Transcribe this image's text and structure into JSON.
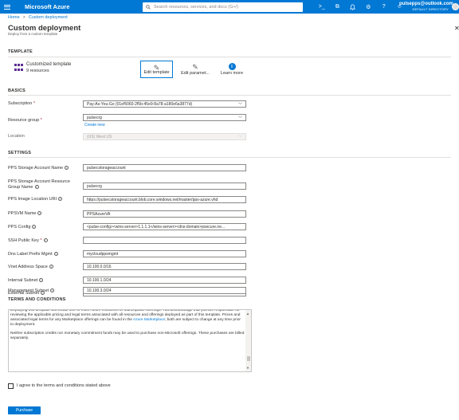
{
  "topbar": {
    "brand": "Microsoft Azure",
    "search_placeholder": "Search resources, services, and docs (G+/)",
    "icons": [
      "terminal-icon",
      "directory-filter-icon",
      "bell-icon",
      "gear-icon",
      "help-icon",
      "feedback-icon"
    ],
    "icon_glyphs": [
      ">_",
      "⧉",
      "🔔",
      "⚙",
      "?",
      "☺"
    ],
    "user_email": "pulsepps@outlook.com",
    "user_dir": "DEFAULT DIRECTORY"
  },
  "breadcrumb": {
    "home": "Home",
    "sep": ">",
    "current": "Custom deployment"
  },
  "page": {
    "title": "Custom deployment",
    "subtitle": "Deploy from a custom template"
  },
  "template": {
    "heading": "TEMPLATE",
    "name": "Customized template",
    "resources": "9 resources",
    "edit_template": "Edit template",
    "edit_params": "Edit paramet...",
    "learn_more": "Learn more"
  },
  "basics": {
    "heading": "BASICS",
    "subscription_label": "Subscription",
    "subscription_value": "Pay-As-You-Go (01ef5060-2f5b-45e9-8a78-a180e6a3877d)",
    "rg_label": "Resource group",
    "rg_value": "pulsecrg",
    "create_new": "Create new",
    "location_label": "Location",
    "location_value": "(US) West US"
  },
  "settings": {
    "heading": "SETTINGS",
    "fields": [
      {
        "label": "PPS Storage Account Name",
        "value": "pulsecstorageaccount"
      },
      {
        "label": "PPS Storage Account Resource Group Name",
        "value": "pulsecrg"
      },
      {
        "label": "PPS Image Location URI",
        "value": "https://pulsecstorageaccount.blob.core.windows.net/master/pps-azure.vhd"
      },
      {
        "label": "PPSVM Name",
        "value": "PPSAzureVA"
      },
      {
        "label": "PPS Config",
        "value": "<pulse-config><wins-server>1.1.1.1</wins-server><dns-domain>psecure.ne..."
      },
      {
        "label": "SSH Public Key",
        "value": ""
      },
      {
        "label": "Dns Label Prefix Mgmt",
        "value": "mycloudppsmgmt"
      },
      {
        "label": "Vnet Address Space",
        "value": "10.100.0.0/16"
      },
      {
        "label": "Internal Subnet",
        "value": "10.100.1.0/24"
      },
      {
        "label": "External Subnet",
        "value": "10.100.2.0/24"
      },
      {
        "label": "Management Subnet",
        "value": "10.100.3.0/24"
      }
    ]
  },
  "terms": {
    "heading": "TERMS AND CONDITIONS",
    "p1a": "Deploying this template will create one or more Azure resources or Marketplace offerings.  You acknowledge that you are responsible for reviewing the applicable pricing and legal terms associated with all resources and offerings deployed as part of this template.  Prices and associated legal terms for any Marketplace offerings can be found in the",
    "p1link": "Azure Marketplace",
    "p1b": "; both are subject to change at any time prior to deployment.",
    "p2": "Neither subscription credits nor monetary commitment funds may be used to purchase non-Microsoft offerings. These purchases are billed separately.",
    "agree": "I agree to the terms and conditions stated above"
  },
  "purchase": "Purchase",
  "colors": {
    "accent": "#0078d4",
    "required": "#a4262c"
  }
}
